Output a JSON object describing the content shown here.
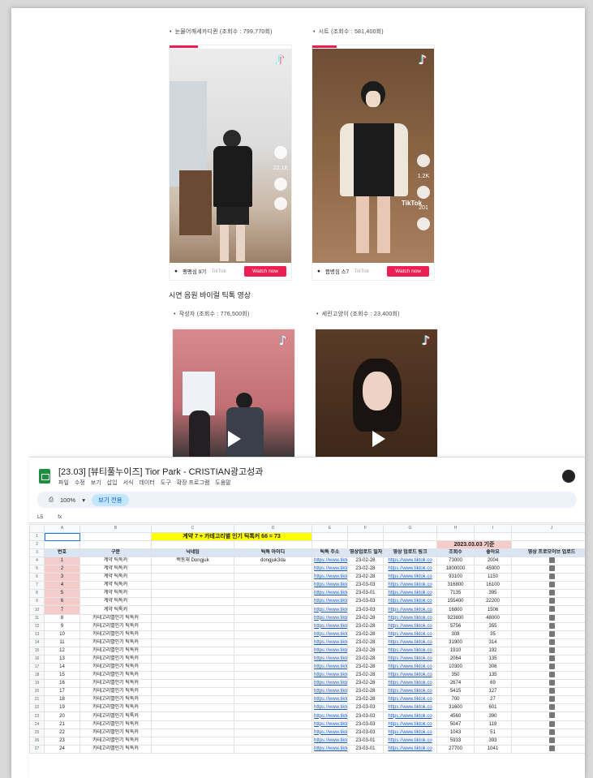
{
  "doc": {
    "captions": [
      "눈물어깨세카디퀸 (조회수 : 799,770회)",
      "시트 (조회수 : 581,400회)",
      "작성자 (조회수 : 776,500회)",
      "세린고양이 (조회수 : 23,400회)"
    ],
    "section_title": "시연 음원 바이럴 틱톡 영상",
    "cards": [
      {
        "user": "팽팽심 9기",
        "small": "TikTok",
        "button": "Watch now"
      },
      {
        "user": "뜸병짐 스7",
        "small": "TikTok",
        "button": "Watch now"
      }
    ],
    "tiktok_label": "TikTok",
    "side_counts": [
      "22.1K",
      "1.2K",
      "201"
    ]
  },
  "sheet": {
    "title": "[23.03] [뷰티풀누이즈] Tior Park - CRISTIAN광고성과",
    "menu": [
      "파일",
      "수정",
      "보기",
      "삽입",
      "서식",
      "데이터",
      "도구",
      "확장 프로그램",
      "도움말"
    ],
    "zoom": "100%",
    "mode_label": "보기 전용",
    "cell_ref": "L5",
    "fx": "fx",
    "columns": [
      "A",
      "B",
      "C",
      "D",
      "E",
      "F",
      "G",
      "H",
      "I",
      "J"
    ],
    "banner": "계약 7 + 카테고리별 인기 틱톡커 66 = 73",
    "date_header": "2023.03.03 기준",
    "headers": [
      "번호",
      "구분",
      "닉네임",
      "틱톡 아이디",
      "틱톡 주소",
      "영상업로드 일자",
      "영상 업로드 링크",
      "조회수",
      "좋아요",
      "영상 프로모이브 업로드"
    ],
    "row_numbers": [
      "1",
      "2",
      "3",
      "4",
      "5",
      "6",
      "7",
      "8",
      "9",
      "10",
      "11",
      "12",
      "13",
      "14",
      "15",
      "16",
      "17",
      "18",
      "19",
      "20",
      "21",
      "22",
      "23",
      "24",
      "25",
      "26",
      "27",
      "28",
      "29"
    ],
    "rows": [
      [
        "1",
        "계약 틱톡커",
        "백동재 Dongjuk",
        "dongjuk3da",
        "https://www.tiktok",
        "23-02-28",
        "https://www.tiktok.co",
        "73000",
        "2004"
      ],
      [
        "2",
        "계약 틱톡커",
        "",
        "",
        "https://www.tiktok",
        "23-02-28",
        "https://www.tiktok.co",
        "1800000",
        "45900"
      ],
      [
        "3",
        "계약 틱톡커",
        "",
        "",
        "https://www.tiktok",
        "23-02-28",
        "https://www.tiktok.co",
        "93100",
        "1150"
      ],
      [
        "4",
        "계약 틱톡커",
        "",
        "",
        "https://www.tiktok",
        "23-03-03",
        "https://www.tiktok.co",
        "316800",
        "16100"
      ],
      [
        "5",
        "계약 틱톡커",
        "",
        "",
        "https://www.tiktok",
        "23-03-01",
        "https://www.tiktok.co",
        "7135",
        "395"
      ],
      [
        "6",
        "계약 틱톡커",
        "",
        "",
        "https://www.tiktok",
        "23-03-03",
        "https://www.tiktok.co",
        "155400",
        "22200"
      ],
      [
        "7",
        "계약 틱톡커",
        "",
        "",
        "https://www.tiktok",
        "23-03-03",
        "https://www.tiktok.co",
        "16800",
        "1506"
      ],
      [
        "8",
        "카테고리별인기 틱톡커",
        "",
        "",
        "https://www.tiktok",
        "23-02-28",
        "https://www.tiktok.co",
        "923800",
        "48000"
      ],
      [
        "9",
        "카테고리별인기 틱톡커",
        "",
        "",
        "https://www.tiktok",
        "23-02-28",
        "https://www.tiktok.co",
        "5756",
        "355"
      ],
      [
        "10",
        "카테고리별인기 틱톡커",
        "",
        "",
        "https://www.tiktok",
        "23-02-28",
        "https://www.tiktok.co",
        "308",
        "35"
      ],
      [
        "11",
        "카테고리별인기 틱톡커",
        "",
        "",
        "https://www.tiktok",
        "23-02-28",
        "https://www.tiktok.co",
        "31900",
        "314"
      ],
      [
        "12",
        "카테고리별인기 틱톡커",
        "",
        "",
        "https://www.tiktok",
        "23-02-28",
        "https://www.tiktok.co",
        "1910",
        "192"
      ],
      [
        "13",
        "카테고리별인기 틱톡커",
        "",
        "",
        "https://www.tiktok",
        "23-02-28",
        "https://www.tiktok.co",
        "2064",
        "135"
      ],
      [
        "14",
        "카테고리별인기 틱톡커",
        "",
        "",
        "https://www.tiktok",
        "23-02-28",
        "https://www.tiktok.co",
        "10300",
        "306"
      ],
      [
        "15",
        "카테고리별인기 틱톡커",
        "",
        "",
        "https://www.tiktok",
        "23-02-28",
        "https://www.tiktok.co",
        "350",
        "135"
      ],
      [
        "16",
        "카테고리별인기 틱톡커",
        "",
        "",
        "https://www.tiktok",
        "23-02-28",
        "https://www.tiktok.co",
        "2674",
        "69"
      ],
      [
        "17",
        "카테고리별인기 틱톡커",
        "",
        "",
        "https://www.tiktok",
        "23-02-28",
        "https://www.tiktok.co",
        "5415",
        "127"
      ],
      [
        "18",
        "카테고리별인기 틱톡커",
        "",
        "",
        "https://www.tiktok",
        "23-02-28",
        "https://www.tiktok.co",
        "700",
        "27"
      ],
      [
        "19",
        "카테고리별인기 틱톡커",
        "",
        "",
        "https://www.tiktok",
        "23-03-03",
        "https://www.tiktok.co",
        "31600",
        "601"
      ],
      [
        "20",
        "카테고리별인기 틱톡커",
        "",
        "",
        "https://www.tiktok",
        "23-03-03",
        "https://www.tiktok.co",
        "4560",
        "390"
      ],
      [
        "21",
        "카테고리별인기 틱톡커",
        "",
        "",
        "https://www.tiktok",
        "23-03-03",
        "https://www.tiktok.co",
        "5047",
        "119"
      ],
      [
        "22",
        "카테고리별인기 틱톡커",
        "",
        "",
        "https://www.tiktok",
        "23-03-03",
        "https://www.tiktok.co",
        "1043",
        "51"
      ],
      [
        "23",
        "카테고리별인기 틱톡커",
        "",
        "",
        "https://www.tiktok",
        "23-03-01",
        "https://www.tiktok.co",
        "5933",
        "393"
      ],
      [
        "24",
        "카테고리별인기 틱톡커",
        "",
        "",
        "https://www.tiktok",
        "23-03-01",
        "https://www.tiktok.co",
        "27700",
        "1041"
      ]
    ]
  }
}
